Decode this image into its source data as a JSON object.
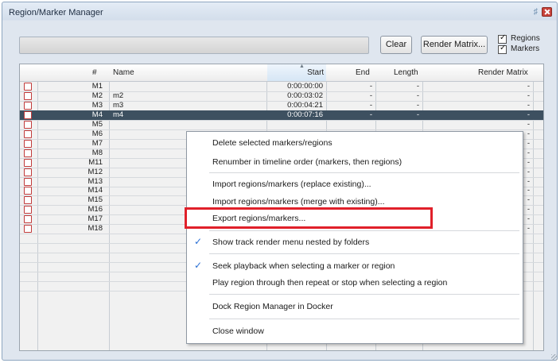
{
  "window": {
    "title": "Region/Marker Manager"
  },
  "toolbar": {
    "filter_value": "",
    "clear_label": "Clear",
    "render_matrix_label": "Render Matrix...",
    "regions_label": "Regions",
    "markers_label": "Markers",
    "regions_checked": true,
    "markers_checked": true
  },
  "table": {
    "columns": [
      "#",
      "Name",
      "Start",
      "End",
      "Length",
      "Render Matrix"
    ],
    "sorted_column": "Start",
    "rows": [
      {
        "num": "M1",
        "name": "",
        "start": "0:00:00:00",
        "end": "-",
        "length": "-",
        "rm": "-"
      },
      {
        "num": "M2",
        "name": "m2",
        "start": "0:00:03:02",
        "end": "-",
        "length": "-",
        "rm": "-"
      },
      {
        "num": "M3",
        "name": "m3",
        "start": "0:00:04:21",
        "end": "-",
        "length": "-",
        "rm": "-"
      },
      {
        "num": "M4",
        "name": "m4",
        "start": "0:00:07:16",
        "end": "-",
        "length": "-",
        "rm": "-"
      },
      {
        "num": "M5",
        "name": "",
        "start": "",
        "end": "",
        "length": "",
        "rm": "-"
      },
      {
        "num": "M6",
        "name": "",
        "start": "",
        "end": "",
        "length": "",
        "rm": "-"
      },
      {
        "num": "M7",
        "name": "",
        "start": "",
        "end": "",
        "length": "",
        "rm": "-"
      },
      {
        "num": "M8",
        "name": "",
        "start": "",
        "end": "",
        "length": "",
        "rm": "-"
      },
      {
        "num": "M11",
        "name": "",
        "start": "",
        "end": "",
        "length": "",
        "rm": "-"
      },
      {
        "num": "M12",
        "name": "",
        "start": "",
        "end": "",
        "length": "",
        "rm": "-"
      },
      {
        "num": "M13",
        "name": "",
        "start": "",
        "end": "",
        "length": "",
        "rm": "-"
      },
      {
        "num": "M14",
        "name": "",
        "start": "",
        "end": "",
        "length": "",
        "rm": "-"
      },
      {
        "num": "M15",
        "name": "",
        "start": "",
        "end": "",
        "length": "",
        "rm": "-"
      },
      {
        "num": "M16",
        "name": "",
        "start": "",
        "end": "",
        "length": "",
        "rm": "-"
      },
      {
        "num": "M17",
        "name": "",
        "start": "",
        "end": "",
        "length": "",
        "rm": "-"
      },
      {
        "num": "M18",
        "name": "",
        "start": "",
        "end": "",
        "length": "",
        "rm": "-"
      }
    ],
    "selected_row": "M4"
  },
  "context_menu": {
    "items": [
      {
        "label": "Delete selected markers/regions",
        "checked": false
      },
      {
        "label": "Renumber in timeline order (markers, then regions)",
        "checked": false
      },
      {
        "label": "Import regions/markers (replace existing)...",
        "checked": false
      },
      {
        "label": "Import regions/markers (merge with existing)...",
        "checked": false
      },
      {
        "label": "Export regions/markers...",
        "checked": false,
        "highlighted": true
      },
      {
        "label": "Show track render menu nested by folders",
        "checked": true
      },
      {
        "label": "Seek playback when selecting a marker or region",
        "checked": true
      },
      {
        "label": "Play region through then repeat or stop when selecting a region",
        "checked": false
      },
      {
        "label": "Dock Region Manager in Docker",
        "checked": false
      },
      {
        "label": "Close window",
        "checked": false
      }
    ]
  },
  "colors": {
    "highlight_box": "#e0202a",
    "row_checkbox": "#c23b3b",
    "selected_row_bg": "#3d5060",
    "check_mark": "#2a6fd4"
  }
}
